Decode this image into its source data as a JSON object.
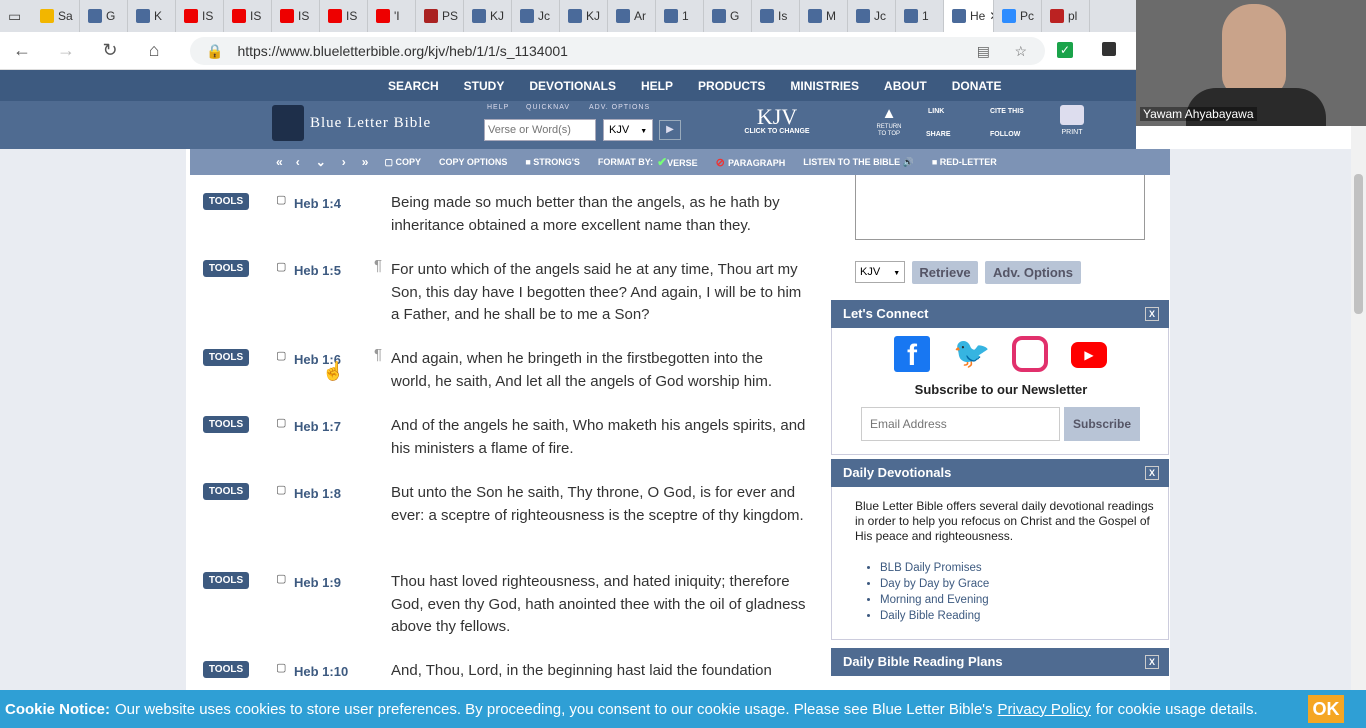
{
  "browser": {
    "tabs": [
      {
        "label": "Sa",
        "color": "#f2b600"
      },
      {
        "label": "G",
        "color": "#4a6a9a"
      },
      {
        "label": "K",
        "color": "#4a6a9a"
      },
      {
        "label": "IS",
        "color": "#e00"
      },
      {
        "label": "IS",
        "color": "#e00"
      },
      {
        "label": "IS",
        "color": "#e00"
      },
      {
        "label": "IS",
        "color": "#e00"
      },
      {
        "label": "'I",
        "color": "#e00"
      },
      {
        "label": "PS",
        "color": "#a22"
      },
      {
        "label": "KJ",
        "color": "#4a6a9a"
      },
      {
        "label": "Jc",
        "color": "#4a6a9a"
      },
      {
        "label": "KJ",
        "color": "#4a6a9a"
      },
      {
        "label": "Ar",
        "color": "#4a6a9a"
      },
      {
        "label": "1",
        "color": "#4a6a9a"
      },
      {
        "label": "G",
        "color": "#4a6a9a"
      },
      {
        "label": "Is",
        "color": "#4a6a9a"
      },
      {
        "label": "M",
        "color": "#4a6a9a"
      },
      {
        "label": "Jc",
        "color": "#4a6a9a"
      },
      {
        "label": "1",
        "color": "#4a6a9a"
      },
      {
        "label": "He",
        "color": "#4a6a9a"
      },
      {
        "label": "Pc",
        "color": "#2d8cff"
      },
      {
        "label": "pl",
        "color": "#b22"
      }
    ],
    "url": "https://www.blueletterbible.org/kjv/heb/1/1/s_1134001"
  },
  "webcam": {
    "name": "Yawam Ahyabayawa"
  },
  "site": {
    "menu": [
      "SEARCH",
      "STUDY",
      "DEVOTIONALS",
      "HELP",
      "PRODUCTS",
      "MINISTRIES",
      "ABOUT",
      "DONATE"
    ],
    "logo": "Blue Letter Bible",
    "labels": {
      "help": "HELP",
      "quicknav": "QUICKNAV",
      "adv": "ADV. OPTIONS"
    },
    "search_placeholder": "Verse or Word(s)",
    "version": "KJV",
    "kjv_big": "KJV",
    "kjv_sub": "CLICK TO CHANGE",
    "return_top": "RETURN TO TOP",
    "link": "LINK",
    "cite": "CITE THIS",
    "share": "SHARE",
    "follow": "FOLLOW",
    "print": "PRINT",
    "toolbar": {
      "copy": "COPY",
      "copy_options": "COPY OPTIONS",
      "strongs": "STRONG'S",
      "format_by": "FORMAT BY:",
      "verse": "VERSE",
      "paragraph": "PARAGRAPH",
      "listen": "LISTEN TO THE BIBLE",
      "red_letter": "RED-LETTER"
    }
  },
  "verses": [
    {
      "ref": "Heb 1:4",
      "text": "Being made so much better than the angels, as he hath by inheritance obtained a more excellent name than they.",
      "para": false
    },
    {
      "ref": "Heb 1:5",
      "text": "For unto which of the angels said he at any time, Thou art my Son, this day have I begotten thee? And again, I will be to him a Father, and he shall be to me a Son?",
      "para": true
    },
    {
      "ref": "Heb 1:6",
      "text": "And again, when he bringeth in the firstbegotten into the world, he saith, And let all the angels of God worship him.",
      "para": true
    },
    {
      "ref": "Heb 1:7",
      "text": "And of the angels he saith, Who maketh his angels spirits, and his ministers a flame of fire.",
      "para": false
    },
    {
      "ref": "Heb 1:8",
      "text": "But unto the Son he saith, Thy throne, O God, is for ever and ever: a sceptre of righteousness is the sceptre of thy kingdom.",
      "para": false
    },
    {
      "ref": "Heb 1:9",
      "text": "Thou hast loved righteousness, and hated iniquity; therefore God, even thy God, hath anointed thee with the oil of gladness above thy fellows.",
      "para": false
    },
    {
      "ref": "Heb 1:10",
      "text": "And, Thou, Lord, in the beginning hast laid the foundation",
      "para": false
    }
  ],
  "tools_label": "TOOLS",
  "para_mark": "¶",
  "sidebar": {
    "version": "KJV",
    "retrieve": "Retrieve",
    "adv_options": "Adv. Options",
    "connect_title": "Let's Connect",
    "newsletter": "Subscribe to our Newsletter",
    "email_placeholder": "Email Address",
    "subscribe": "Subscribe",
    "devotionals_title": "Daily Devotionals",
    "devotionals_text": "Blue Letter Bible offers several daily devotional readings in order to help you refocus on Christ and the Gospel of His peace and righteousness.",
    "devotional_links": [
      "BLB Daily Promises",
      "Day by Day by Grace",
      "Morning and Evening",
      "Daily Bible Reading"
    ],
    "plans_title": "Daily Bible Reading Plans",
    "close": "X"
  },
  "cookie": {
    "title": "Cookie Notice:",
    "text": "Our website uses cookies to store user preferences. By proceeding, you consent to our cookie usage. Please see Blue Letter Bible's",
    "link": "Privacy Policy",
    "tail": "for cookie usage details.",
    "ok": "OK"
  }
}
